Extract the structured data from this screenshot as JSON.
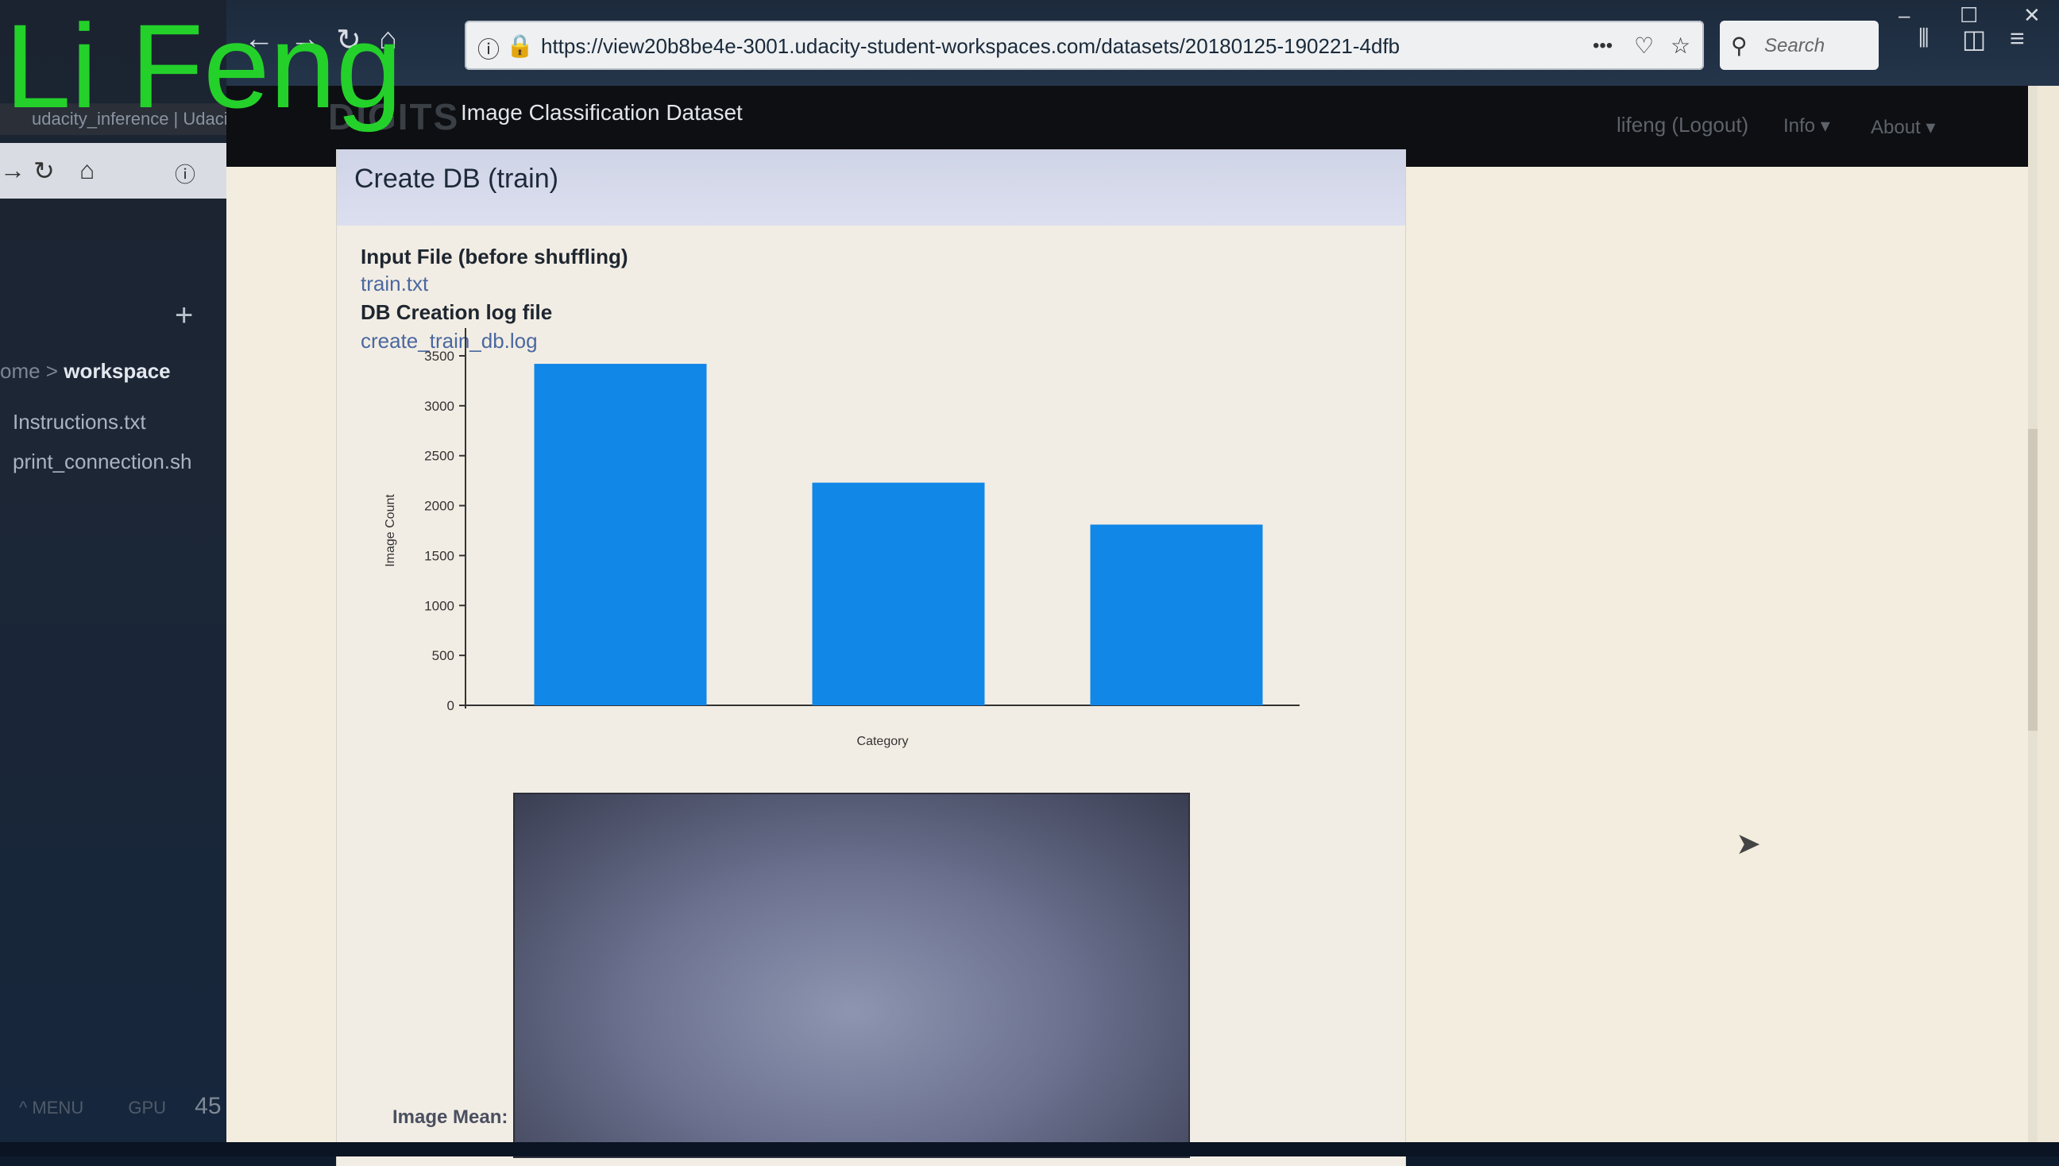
{
  "watermark": "Li Feng",
  "left_panel": {
    "tab_title": "udacity_inference | Udaci",
    "add_label": "+",
    "breadcrumb_prefix": "ome >",
    "breadcrumb_current": "workspace",
    "files": [
      "Instructions.txt",
      "print_connection.sh"
    ],
    "footer_menu": "^ MENU",
    "footer_gpu": "GPU",
    "footer_number": "45"
  },
  "browser": {
    "url": "https://view20b8be4e-3001.udacity-student-workspaces.com/datasets/20180125-190221-4dfb",
    "search_placeholder": "Search",
    "more_label": "•••"
  },
  "navbar": {
    "brand": "DIGITS",
    "page_heading": "Image Classification Dataset",
    "user_link": "lifeng (Logout)",
    "info_menu": "Info ▾",
    "about_menu": "About ▾"
  },
  "panel": {
    "title": "Create DB (train)",
    "input_file_label": "Input File (before shuffling)",
    "input_file_link": "train.txt",
    "log_label": "DB Creation log file",
    "log_link": "create_train_db.log",
    "image_mean_label": "Image Mean:"
  },
  "chart_data": {
    "type": "bar",
    "categories": [
      "",
      "",
      ""
    ],
    "values": [
      3420,
      2230,
      1810
    ],
    "xlabel": "Category",
    "ylabel": "Image Count",
    "ylim": [
      0,
      3500
    ],
    "yticks": [
      0,
      500,
      1000,
      1500,
      2000,
      2500,
      3000,
      3500
    ],
    "bar_color": "#1187e8",
    "grid": false
  },
  "colors": {
    "watermark": "#24d12a",
    "navbar_bg": "#0d0f12",
    "panel_header": "#cfd4e6",
    "link": "#4a68a0"
  }
}
